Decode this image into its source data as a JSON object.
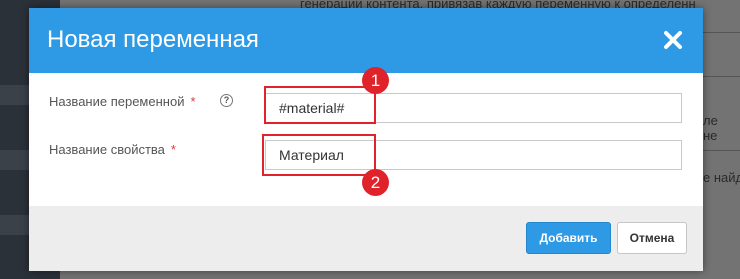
{
  "background": {
    "top_text": "генерации контента, привязав каждую переменную к определенн",
    "right_snippets": [
      "ле",
      "не",
      "е найд"
    ]
  },
  "dialog": {
    "title": "Новая переменная",
    "close_icon": "close-icon",
    "fields": [
      {
        "label": "Название переменной",
        "required_mark": "*",
        "help_icon": "?",
        "value": "#material#"
      },
      {
        "label": "Название свойства",
        "required_mark": "*",
        "value": "Материал"
      }
    ],
    "add_label": "Добавить",
    "cancel_label": "Отмена"
  },
  "annotations": [
    "1",
    "2"
  ],
  "colors": {
    "header": "#2e9ae6",
    "annotation": "#e0232a",
    "footer": "#ededed"
  }
}
